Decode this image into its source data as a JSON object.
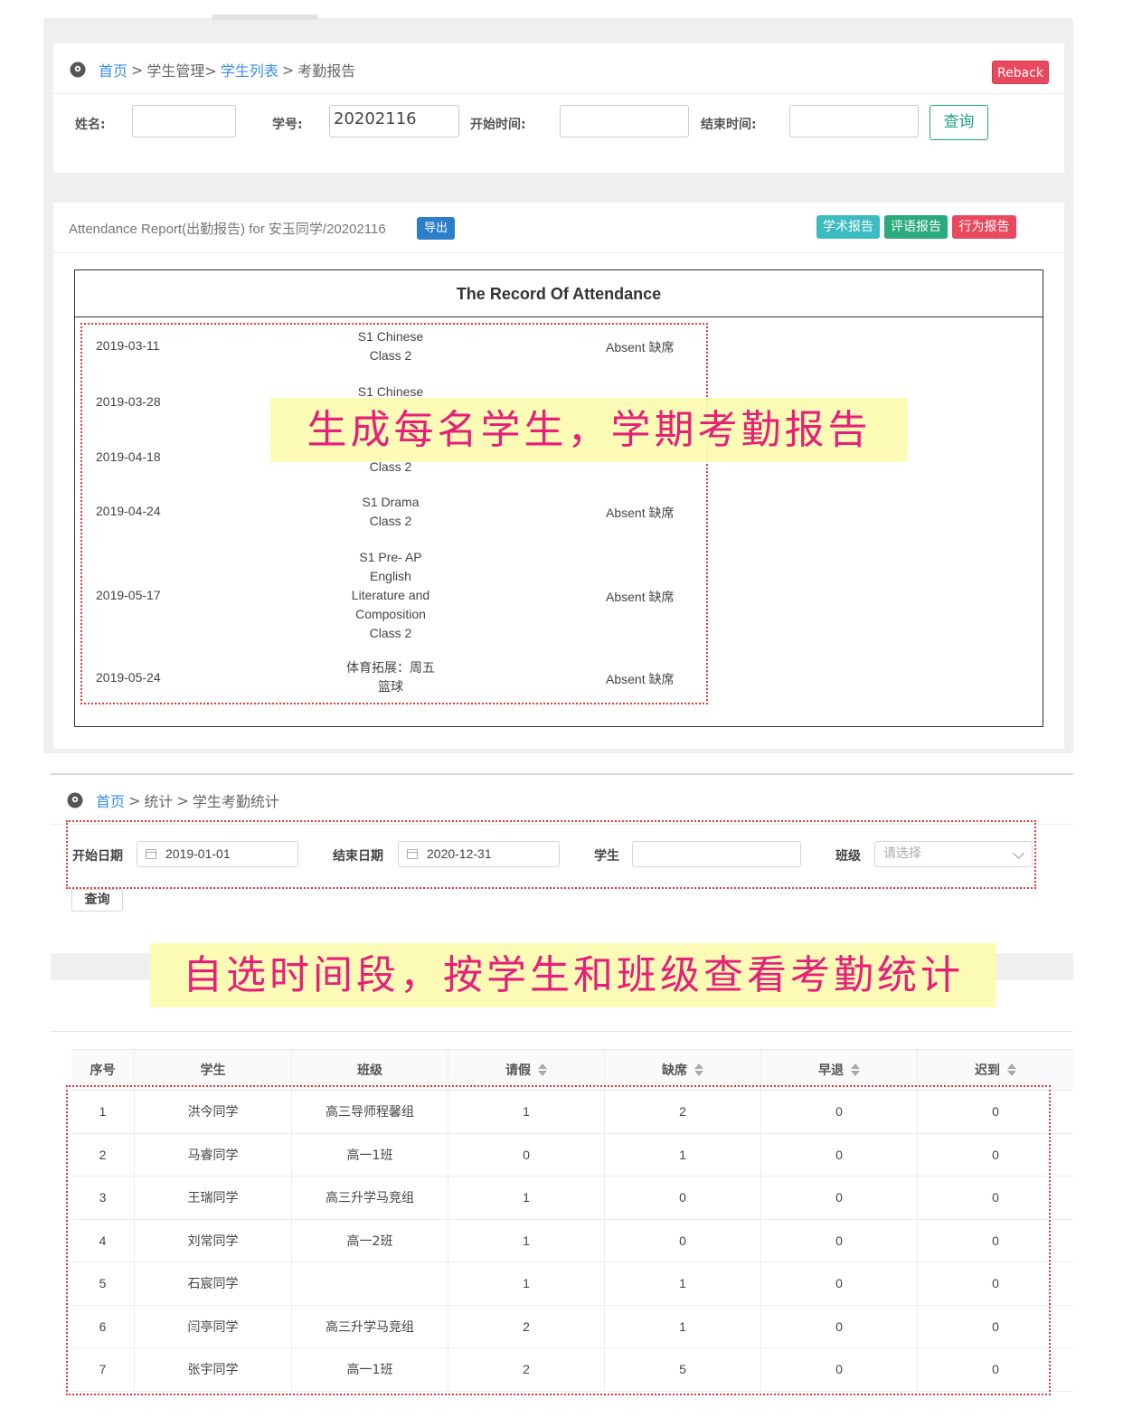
{
  "top": {
    "breadcrumb": {
      "home": "首页",
      "sep1": ">",
      "mgmt": "学生管理>",
      "list": "学生列表",
      "sep2": ">",
      "current": "考勤报告"
    },
    "reback_label": "Reback",
    "filters": {
      "name_label": "姓名:",
      "name_value": "",
      "id_label": "学号:",
      "id_value": "20202116",
      "start_label": "开始时间:",
      "start_value": "",
      "end_label": "结束时间:",
      "end_value": "",
      "query_label": "查询"
    },
    "report_title": "Attendance Report(出勤报告) for 安玉同学/20202116",
    "export_label": "导出",
    "tags": {
      "academic": "学术报告",
      "comment": "评语报告",
      "behavior": "行为报告"
    },
    "record_title": "The Record Of Attendance",
    "records": [
      {
        "date": "2019-03-11",
        "class_lines": [
          "S1 Chinese",
          "Class 2"
        ],
        "status": "Absent 缺席"
      },
      {
        "date": "2019-03-28",
        "class_lines": [
          "S1 Chinese"
        ],
        "status": ""
      },
      {
        "date": "2019-04-18",
        "class_lines": [
          "Class 2"
        ],
        "status": ""
      },
      {
        "date": "2019-04-24",
        "class_lines": [
          "S1 Drama",
          "Class 2"
        ],
        "status": "Absent 缺席"
      },
      {
        "date": "2019-05-17",
        "class_lines": [
          "S1 Pre- AP",
          "English",
          "Literature and",
          "Composition",
          "Class 2"
        ],
        "status": "Absent 缺席"
      },
      {
        "date": "2019-05-24",
        "class_lines": [
          "体育拓展：周五",
          "篮球"
        ],
        "status": "Absent 缺席"
      }
    ],
    "banner": "生成每名学生，学期考勤报告"
  },
  "bottom": {
    "breadcrumb": {
      "home": "首页",
      "sep1": ">",
      "stats": "统计",
      "sep2": ">",
      "current": "学生考勤统计"
    },
    "filters": {
      "start_label": "开始日期",
      "start_value": "2019-01-01",
      "end_label": "结束日期",
      "end_value": "2020-12-31",
      "student_label": "学生",
      "student_value": "",
      "class_label": "班级",
      "class_placeholder": "请选择",
      "query_label": "查询"
    },
    "banner": "自选时间段，按学生和班级查看考勤统计",
    "table": {
      "headers": [
        "序号",
        "学生",
        "班级",
        "请假",
        "缺席",
        "早退",
        "迟到"
      ],
      "rows": [
        [
          "1",
          "洪今同学",
          "高三导师程馨组",
          "1",
          "2",
          "0",
          "0"
        ],
        [
          "2",
          "马睿同学",
          "高一1班",
          "0",
          "1",
          "0",
          "0"
        ],
        [
          "3",
          "王瑞同学",
          "高三升学马竞组",
          "1",
          "0",
          "0",
          "0"
        ],
        [
          "4",
          "刘常同学",
          "高一2班",
          "1",
          "0",
          "0",
          "0"
        ],
        [
          "5",
          "石宸同学",
          "",
          "1",
          "1",
          "0",
          "0"
        ],
        [
          "6",
          "闫亭同学",
          "高三升学马竞组",
          "2",
          "1",
          "0",
          "0"
        ],
        [
          "7",
          "张宇同学",
          "高一1班",
          "2",
          "5",
          "0",
          "0"
        ]
      ]
    }
  },
  "colors": {
    "link": "#3a8ee6",
    "reback": "#e9495e",
    "query": "#1fa37d",
    "export": "#2d7ec9",
    "tag_academic": "#3cbcc0",
    "tag_comment": "#2aaa7e",
    "tag_behavior": "#e9495e",
    "banner_text": "#e61f79",
    "dotted": "#e03b3b"
  },
  "icons": {
    "location": "location-pin-icon",
    "calendar": "calendar-icon",
    "sort": "sort-icon",
    "dropdown": "chevron-down-icon"
  }
}
